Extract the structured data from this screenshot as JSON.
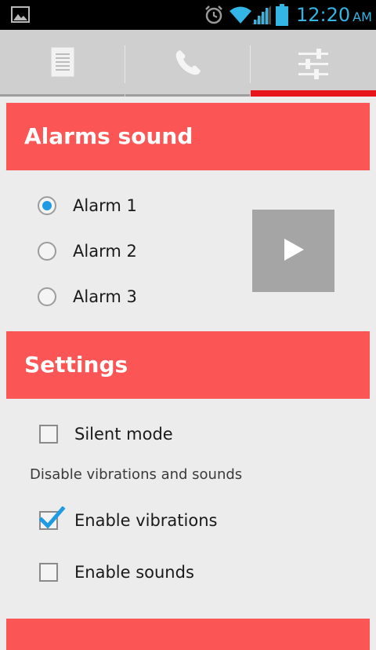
{
  "status_bar": {
    "time": "12:20",
    "ampm": "AM",
    "accent_color": "#33b5e5",
    "icons": [
      "gallery-icon",
      "alarm-clock-icon",
      "wifi-icon",
      "signal-icon",
      "battery-icon"
    ]
  },
  "tabs": [
    {
      "icon": "document-icon",
      "selected": false
    },
    {
      "icon": "phone-icon",
      "selected": false
    },
    {
      "icon": "sliders-icon",
      "selected": true
    }
  ],
  "alarms_section": {
    "title": "Alarms sound",
    "options": [
      {
        "label": "Alarm 1",
        "selected": true
      },
      {
        "label": "Alarm 2",
        "selected": false
      },
      {
        "label": "Alarm 3",
        "selected": false
      }
    ],
    "play_icon": "play-icon"
  },
  "settings_section": {
    "title": "Settings",
    "silent_mode": {
      "label": "Silent mode",
      "checked": false
    },
    "hint": "Disable vibrations and sounds",
    "enable_vibrations": {
      "label": "Enable vibrations",
      "checked": true
    },
    "enable_sounds": {
      "label": "Enable sounds",
      "checked": false
    }
  },
  "colors": {
    "header_bg": "#fc5555",
    "tab_selected_underline": "#e8141c",
    "radio_selected": "#1e9be3"
  }
}
